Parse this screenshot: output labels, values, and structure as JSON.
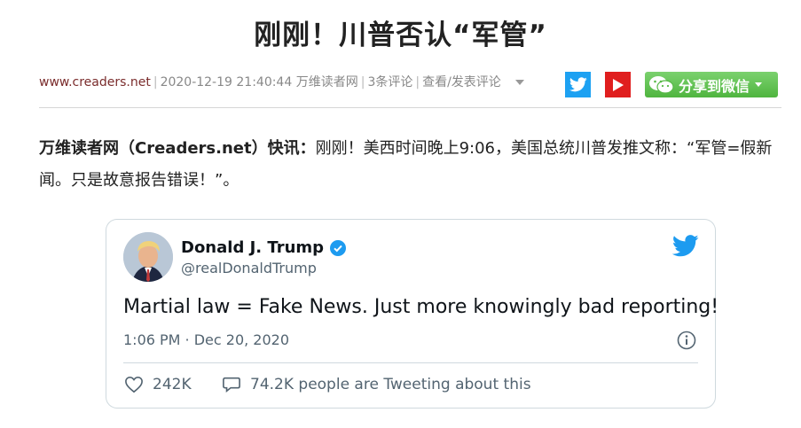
{
  "headline": "刚刚！川普否认“军管”",
  "meta": {
    "site": "www.creaders.net",
    "datetime": "2020-12-19 21:40:44",
    "source": "万维读者网",
    "comments": "3条评论",
    "view_post_comments": "查看/发表评论"
  },
  "share": {
    "twitter_icon": "twitter-icon",
    "youtube_icon": "youtube-icon",
    "wechat_label": "分享到微信",
    "colors": {
      "twitter": "#1da1f2",
      "youtube": "#e01e1e",
      "wechat": "#57b947"
    }
  },
  "article": {
    "lead": "万维读者网（Creaders.net）快讯：",
    "body": "刚刚！美西时间晚上9:06，美国总统川普发推文称：“军管=假新闻。只是故意报告错误！”。"
  },
  "tweet": {
    "author_name": "Donald J. Trump",
    "handle": "@realDonaldTrump",
    "text": "Martial law = Fake News. Just more knowingly bad reporting!",
    "time": "1:06 PM · Dec 20, 2020",
    "likes": "242K",
    "discussion": "74.2K people are Tweeting about this"
  }
}
